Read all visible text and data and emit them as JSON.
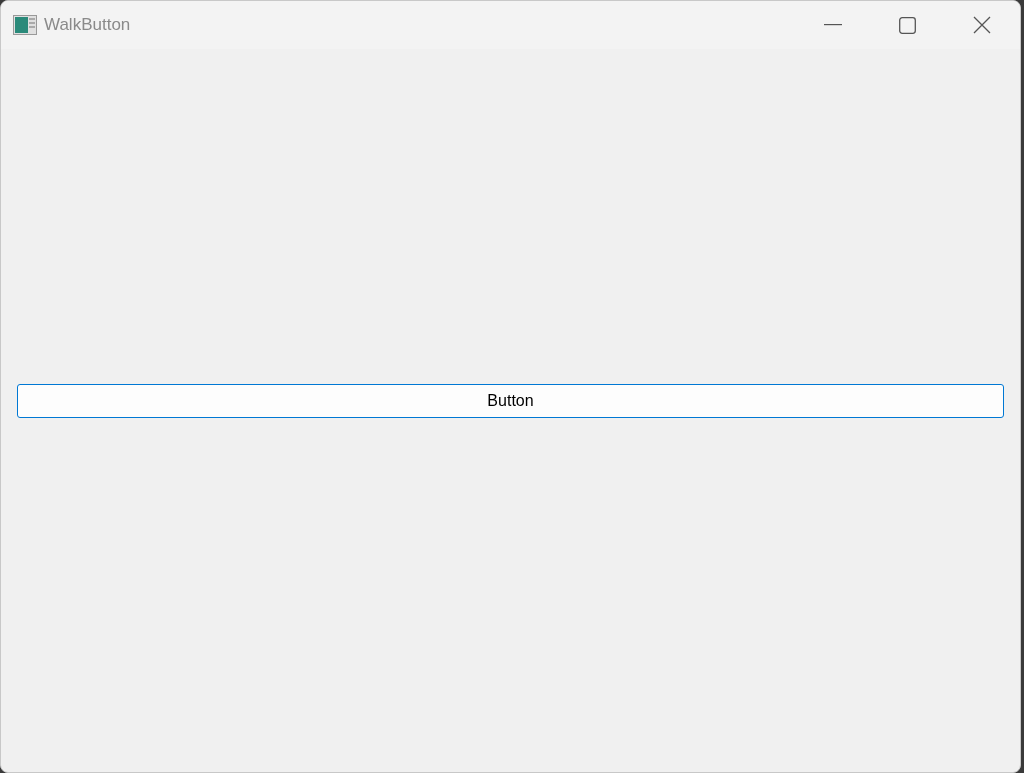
{
  "window": {
    "title": "WalkButton"
  },
  "button": {
    "label": "Button",
    "focused": true
  }
}
